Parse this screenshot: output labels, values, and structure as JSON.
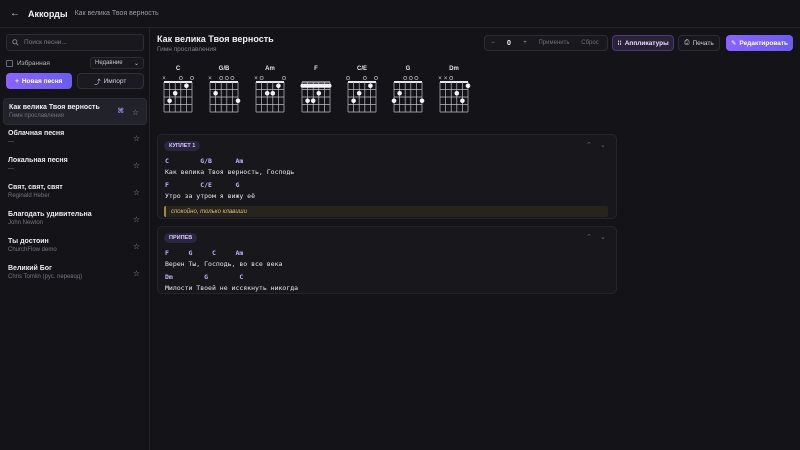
{
  "topbar": {
    "back_icon": "arrow-left-icon",
    "app_title": "Аккорды",
    "breadcrumb": "Как велика Твоя верность"
  },
  "sidebar": {
    "search_placeholder": "Поиск песни...",
    "favorites_label": "Избранная",
    "sort_value": "Недавние",
    "new_song_label": "Новая песня",
    "import_label": "Импорт",
    "songs": [
      {
        "title": "Как велика Твоя верность",
        "subtitle": "Гимн прославления",
        "active": true
      },
      {
        "title": "Облачная песня",
        "subtitle": "—"
      },
      {
        "title": "Локальная песня",
        "subtitle": "—"
      },
      {
        "title": "Свят, свят, свят",
        "subtitle": "Reginald Heber"
      },
      {
        "title": "Благодать удивительна",
        "subtitle": "John Newton"
      },
      {
        "title": "Ты достоин",
        "subtitle": "ChurchFlow demo"
      },
      {
        "title": "Великий Бог",
        "subtitle": "Chris Tomlin (рус. перевод)"
      }
    ]
  },
  "song": {
    "title": "Как велика Твоя верность",
    "subtitle": "Гимн прославления"
  },
  "toolbar": {
    "minus": "−",
    "transpose_value": "0",
    "plus": "+",
    "apply_label": "Применить",
    "reset_label": "Сброс",
    "fingering_label": "Аппликатуры",
    "print_label": "Печать",
    "edit_label": "Редактировать"
  },
  "chord_diagrams": [
    {
      "name": "C",
      "strings": [
        "x",
        "3",
        "2",
        "0",
        "1",
        "0"
      ]
    },
    {
      "name": "G/B",
      "strings": [
        "x",
        "2",
        "0",
        "0",
        "0",
        "3"
      ]
    },
    {
      "name": "Am",
      "strings": [
        "x",
        "0",
        "2",
        "2",
        "1",
        "0"
      ]
    },
    {
      "name": "F",
      "strings": [
        "1",
        "3",
        "3",
        "2",
        "1",
        "1"
      ],
      "barre": 1
    },
    {
      "name": "C/E",
      "strings": [
        "0",
        "3",
        "2",
        "0",
        "1",
        "0"
      ]
    },
    {
      "name": "G",
      "strings": [
        "3",
        "2",
        "0",
        "0",
        "0",
        "3"
      ]
    },
    {
      "name": "Dm",
      "strings": [
        "x",
        "x",
        "0",
        "2",
        "3",
        "1"
      ]
    }
  ],
  "sections": [
    {
      "label": "КУПЛЕТ 1",
      "lines": [
        {
          "chords": "C        G/B      Am",
          "lyrics": "Как велика Твоя верность, Господь"
        },
        {
          "chords": "F        C/E      G",
          "lyrics": "Утро за утром я вижу её"
        }
      ],
      "note": "спокойно, только клавиши"
    },
    {
      "label": "ПРИПЕВ",
      "lines": [
        {
          "chords": "F     G     C     Am",
          "lyrics": "Верен Ты, Господь, во все века"
        },
        {
          "chords": "Dm        G        C",
          "lyrics": "Милости Твоей не иссякнуть никогда"
        }
      ]
    }
  ],
  "colors": {
    "accent": "#8a63ff",
    "chord_text": "#c4b5fd",
    "background": "#141418"
  }
}
